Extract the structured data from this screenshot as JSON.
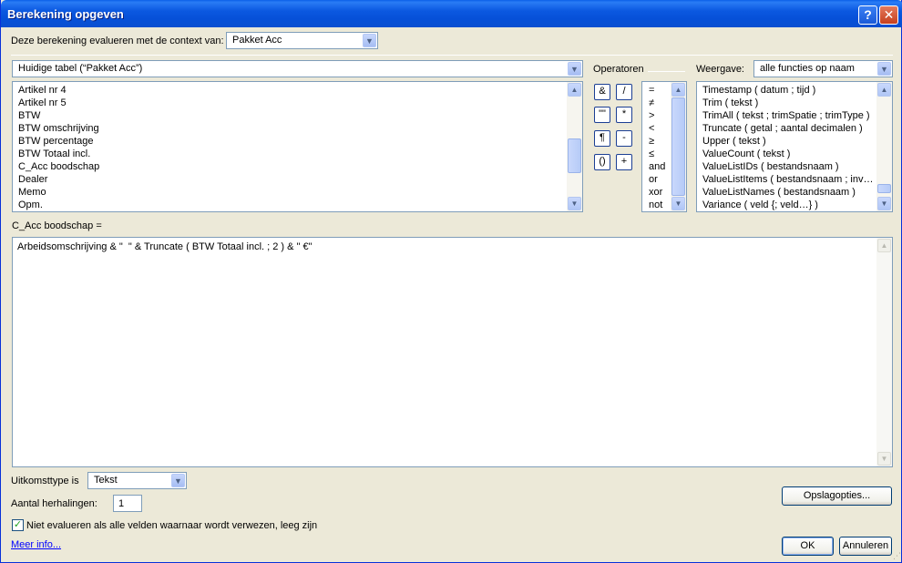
{
  "window": {
    "title": "Berekening opgeven",
    "help_label": "?",
    "close_label": "✕"
  },
  "context": {
    "label": "Deze berekening evalueren met de context van:",
    "value": "Pakket Acc"
  },
  "table_select": {
    "value": "Huidige tabel (“Pakket Acc”)"
  },
  "operators": {
    "label": "Operatoren",
    "buttons": [
      "&",
      "/",
      "\"\"",
      "*",
      "¶",
      "-",
      "()",
      "+"
    ],
    "list": [
      "=",
      "≠",
      ">",
      "<",
      "≥",
      "≤",
      "and",
      "or",
      "xor",
      "not"
    ]
  },
  "view": {
    "label": "Weergave:",
    "value": "alle functies op naam"
  },
  "fields": [
    "Artikel nr 4",
    "Artikel nr 5",
    "BTW",
    "BTW omschrijving",
    "BTW percentage",
    "BTW Totaal incl.",
    "C_Acc boodschap",
    "Dealer",
    "Memo",
    "Opm."
  ],
  "functions": [
    "Timestamp ( datum ; tijd )",
    "Trim ( tekst )",
    "TrimAll ( tekst ; trimSpatie ; trimType )",
    "Truncate ( getal ; aantal decimalen )",
    "Upper ( tekst )",
    "ValueCount ( tekst )",
    "ValueListIDs ( bestandsnaam )",
    "ValueListItems ( bestandsnaam ; inv…",
    "ValueListNames ( bestandsnaam )",
    "Variance ( veld {; veld…} )"
  ],
  "target_field": "C_Acc boodschap =",
  "formula": "Arbeidsomschrijving & \"  \" & Truncate ( BTW Totaal incl. ; 2 ) & \" €\"",
  "result_type": {
    "label": "Uitkomsttype is",
    "value": "Tekst"
  },
  "repetitions": {
    "label": "Aantal herhalingen:",
    "value": "1"
  },
  "no_eval_checkbox": {
    "label": "Niet evalueren als alle velden waarnaar wordt verwezen, leeg zijn",
    "checked": true
  },
  "more_info_link": "Meer info...",
  "buttons": {
    "storage": "Opslagopties...",
    "ok": "OK",
    "cancel": "Annuleren"
  },
  "colors": {
    "titlebar": "#0a56e0",
    "dialog_bg": "#ece9d8",
    "checkmark": "#21a121",
    "link": "#0000ff"
  }
}
